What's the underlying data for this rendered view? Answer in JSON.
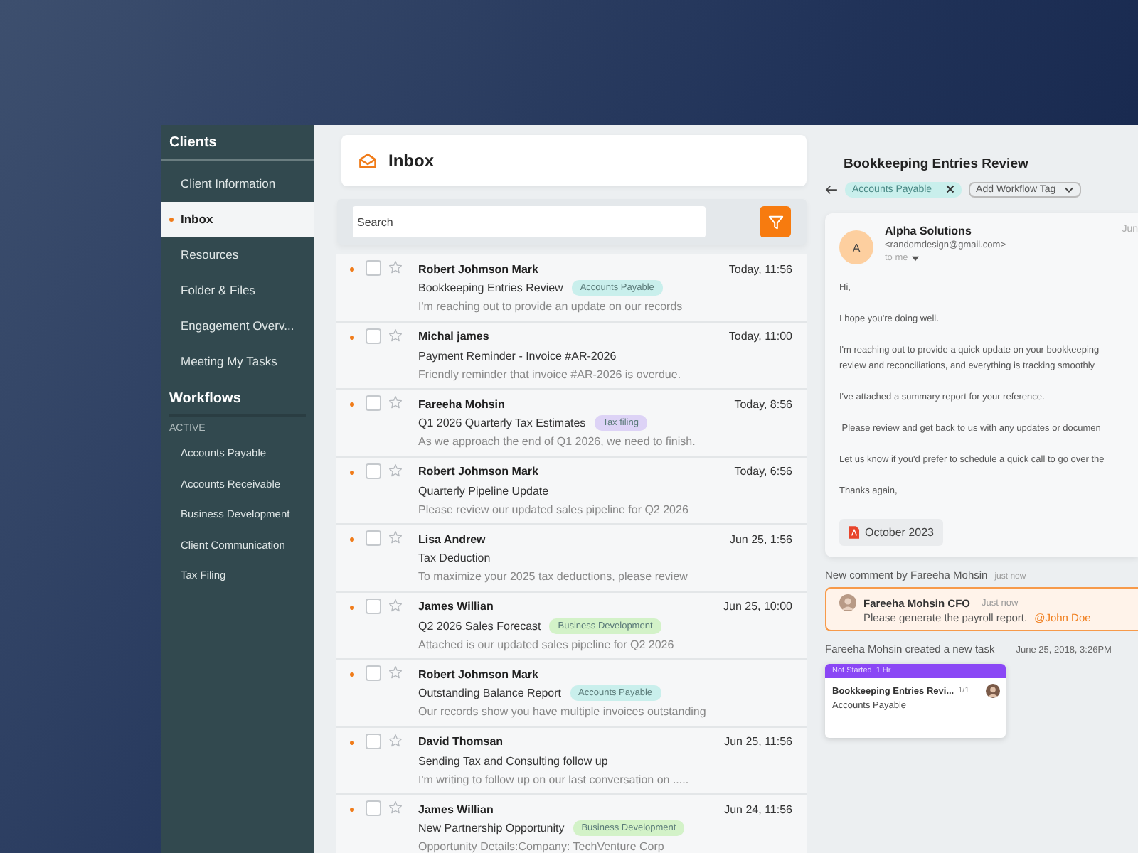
{
  "sidebar": {
    "title": "Clients",
    "items": [
      {
        "label": "Client Information",
        "selected": false
      },
      {
        "label": "Inbox",
        "selected": true
      },
      {
        "label": "Resources",
        "selected": false
      },
      {
        "label": "Folder & Files",
        "selected": false
      },
      {
        "label": "Engagement Overv...",
        "selected": false
      },
      {
        "label": "Meeting My Tasks",
        "selected": false
      }
    ],
    "workflows": {
      "title": "Workflows",
      "group": "ACTIVE",
      "items": [
        "Accounts Payable",
        "Accounts Receivable",
        "Business Development",
        "Client Communication",
        "Tax Filing"
      ]
    }
  },
  "inbox": {
    "title": "Inbox",
    "search": {
      "placeholder": "Search"
    },
    "messages": [
      {
        "sender": "Robert Johmson Mark",
        "time": "Today, 11:56",
        "subject": "Bookkeeping  Entries Review",
        "tag": {
          "label": "Accounts Payable",
          "color": "#c9efec"
        },
        "preview": "I'm reaching out to provide an update on our records",
        "unread": true,
        "checked": false,
        "starred": false
      },
      {
        "sender": "Michal james",
        "time": "Today, 11:00",
        "subject": "Payment Reminder - Invoice #AR-2026",
        "preview": "Friendly reminder that invoice #AR-2026 is overdue.",
        "unread": true,
        "checked": false,
        "starred": false
      },
      {
        "sender": "Fareeha Mohsin",
        "time": "Today, 8:56",
        "subject": "Q1 2026 Quarterly Tax Estimates",
        "tag": {
          "label": "Tax filing",
          "color": "#ddd3f6"
        },
        "preview": "As we approach the end of Q1 2026, we need to finish.",
        "unread": true,
        "checked": false,
        "starred": false
      },
      {
        "sender": "Robert Johmson Mark",
        "time": "Today, 6:56",
        "subject": "Quarterly Pipeline Update",
        "preview": "Please review our updated sales pipeline for Q2 2026",
        "unread": true,
        "checked": false,
        "starred": false
      },
      {
        "sender": "Lisa Andrew",
        "time": "Jun 25, 1:56",
        "subject": "Tax Deduction",
        "preview": "To maximize your 2025 tax deductions, please review",
        "unread": true,
        "checked": false,
        "starred": false
      },
      {
        "sender": "James Willian",
        "time": "Jun 25, 10:00",
        "subject": "Q2 2026 Sales Forecast",
        "tag": {
          "label": "Business Development",
          "color": "#d3f2c8"
        },
        "preview": "Attached is our updated sales pipeline for Q2 2026",
        "unread": true,
        "checked": false,
        "starred": false
      },
      {
        "sender": "Robert Johmson Mark",
        "subject": "Outstanding Balance Report",
        "tag": {
          "label": "Accounts Payable",
          "color": "#c9efec"
        },
        "preview": "Our records show you have multiple invoices outstanding",
        "unread": true,
        "checked": false,
        "starred": false
      },
      {
        "sender": "David Thomsan",
        "time": "Jun 25, 11:56",
        "subject": "Sending Tax and Consulting follow up",
        "preview": "I'm writing to follow up on our last conversation on .....",
        "unread": true,
        "checked": false,
        "starred": false
      },
      {
        "sender": "James Willian",
        "time": "Jun 24, 11:56",
        "subject": "New Partnership Opportunity",
        "tag": {
          "label": "Business Development",
          "color": "#d3f2c8"
        },
        "preview": "Opportunity Details:Company: TechVenture Corp",
        "unread": true,
        "checked": false,
        "starred": false
      }
    ]
  },
  "detail": {
    "title": "Bookkeeping Entries Review",
    "tag": {
      "label": "Accounts Payable",
      "color": "#c9efec"
    },
    "add_tag": "Add Workflow Tag",
    "email": {
      "avatar": "A",
      "sender": "Alpha Solutions",
      "address": "<randomdesign@gmail.com>",
      "recipient": "to me",
      "date": "Jun",
      "body": [
        "Hi,",
        "I hope you're doing well.",
        "I'm reaching out to provide a quick update on your bookkeeping\nreview and reconciliations, and everything is tracking smoothly",
        "I've attached a summary report for your reference.",
        " Please review and get back to us with any updates or documen",
        "Let us know if you'd prefer to schedule a quick call to go over the",
        "Thanks again,"
      ],
      "attachment": "October 2023"
    },
    "comment_notice": {
      "text": "New comment by Fareeha Mohsin",
      "time": "just now"
    },
    "comment": {
      "author": "Fareeha Mohsin CFO",
      "time": "Just now",
      "text": "Please generate the payroll report.",
      "mention": "@John Doe"
    },
    "task_notice": {
      "text": "Fareeha Mohsin created a new task",
      "time": "June 25, 2018, 3:26PM"
    },
    "task": {
      "status": "Not Started",
      "duration": "1 Hr",
      "title": "Bookkeeping Entries Revi...",
      "count": "1/1",
      "tag": "Accounts Payable"
    }
  }
}
